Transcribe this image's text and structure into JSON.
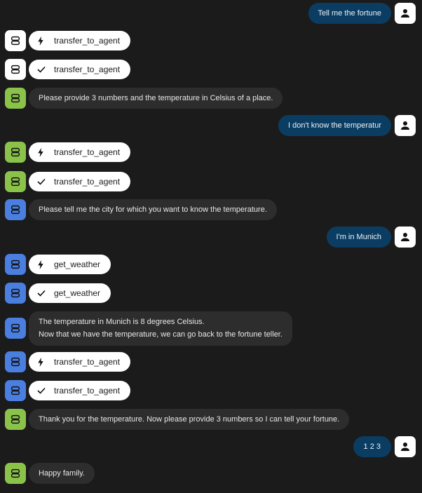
{
  "colors": {
    "background": "#1b1b1b",
    "user_bubble": "#0b3d62",
    "agent_bubble": "#2d2d2d",
    "avatar_white": "#ffffff",
    "avatar_green": "#8bc34a",
    "avatar_blue": "#4a7fe0"
  },
  "conversation": {
    "user_1": "Tell me the fortune",
    "call_1": "transfer_to_agent",
    "resp_1": "transfer_to_agent",
    "agent_1": "Please provide 3 numbers and the temperature in Celsius of a place.",
    "user_2": "I don't know the temperatur",
    "call_2": "transfer_to_agent",
    "resp_2": "transfer_to_agent",
    "agent_2": "Please tell me the city for which you want to know the temperature.",
    "user_3": "I'm in Munich",
    "call_3": "get_weather",
    "resp_3": "get_weather",
    "agent_3_line1": "The temperature in Munich is 8 degrees Celsius.",
    "agent_3_line2": "Now that we have the temperature, we can go back to the fortune teller.",
    "call_4": "transfer_to_agent",
    "resp_4": "transfer_to_agent",
    "agent_4": "Thank you for the temperature. Now please provide 3 numbers so I can tell your fortune.",
    "user_4": "1 2 3",
    "agent_5": "Happy family."
  },
  "icons": {
    "user_avatar": "person-icon",
    "agent_avatar": "robot-icon",
    "function_call": "bolt-icon",
    "function_response": "check-icon"
  }
}
